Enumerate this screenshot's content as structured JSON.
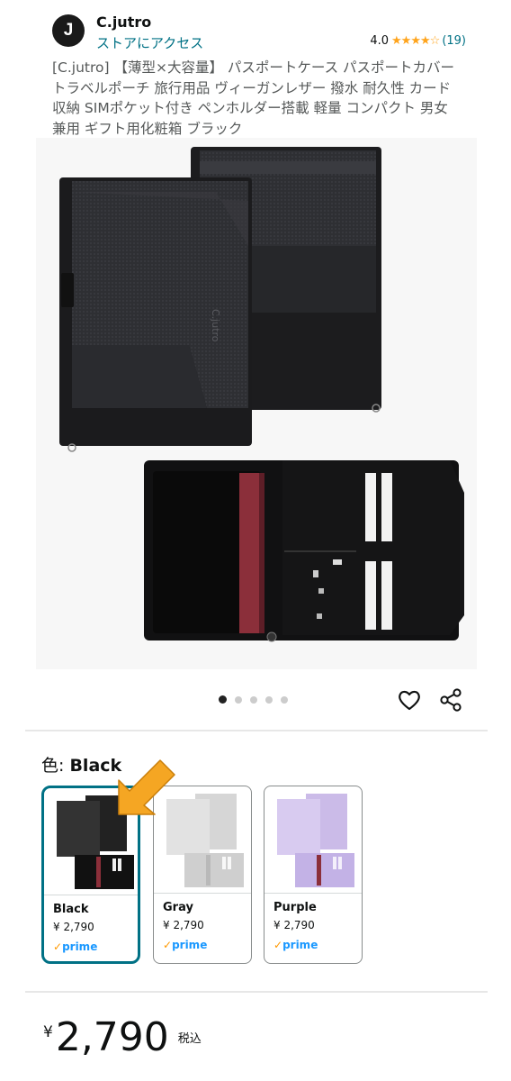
{
  "store": {
    "logo_letter": "J",
    "name": "C.jutro",
    "link_label": "ストアにアクセス",
    "rating": "4.0",
    "stars": "★★★★☆",
    "review_count": "(19)"
  },
  "product": {
    "title": "[C.jutro] 【薄型×大容量】 パスポートケース パスポートカバー トラベルポーチ 旅行用品 ヴィーガンレザー 撥水 耐久性 カード収納 SIMポケット付き ペンホルダー搭載 軽量 コンパクト 男女兼用 ギフト用化粧箱 ブラック",
    "image_count": 5,
    "active_image": 1,
    "brand_emboss": "C.jutro"
  },
  "icons": {
    "heart": "heart-icon",
    "share": "share-icon"
  },
  "color_selector": {
    "label": "色:",
    "selected": "Black",
    "options": [
      {
        "name": "Black",
        "price": "¥ 2,790",
        "prime": "prime",
        "color": "#2b2b2b",
        "selected": true
      },
      {
        "name": "Gray",
        "price": "¥ 2,790",
        "prime": "prime",
        "color": "#cfcfcf",
        "selected": false
      },
      {
        "name": "Purple",
        "price": "¥ 2,790",
        "prime": "prime",
        "color": "#c8b8e6",
        "selected": false
      }
    ]
  },
  "price": {
    "currency": "¥",
    "amount": "2,790",
    "tax_label": "税込"
  },
  "colors": {
    "link": "#007185",
    "star": "#ffa41c",
    "prime": "#1a98ff",
    "arrow": "#f5a623",
    "selected_border": "#007185"
  }
}
